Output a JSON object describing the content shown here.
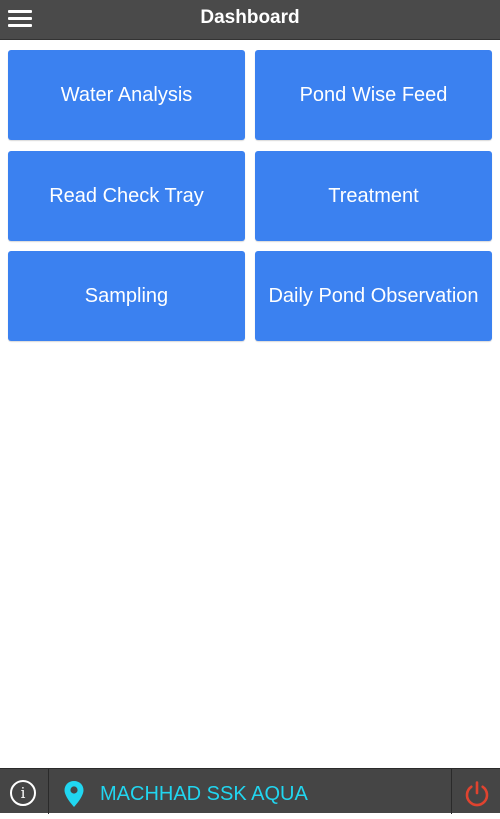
{
  "header": {
    "title": "Dashboard",
    "menu_icon": "hamburger-menu-icon"
  },
  "tiles": [
    {
      "label": "Water Analysis"
    },
    {
      "label": "Pond Wise Feed"
    },
    {
      "label": "Read Check Tray"
    },
    {
      "label": "Treatment"
    },
    {
      "label": "Sampling"
    },
    {
      "label": "Daily Pond Observation"
    }
  ],
  "footer": {
    "info_icon": "info-icon",
    "info_glyph": "i",
    "location_icon": "location-pin-icon",
    "location_name": "MACHHAD SSK AQUA",
    "power_icon": "power-icon"
  },
  "colors": {
    "app_bar": "#4a4a4a",
    "tile": "#3b81f0",
    "footer": "#454545",
    "location_text": "#21d6f0",
    "power": "#e0432f"
  }
}
